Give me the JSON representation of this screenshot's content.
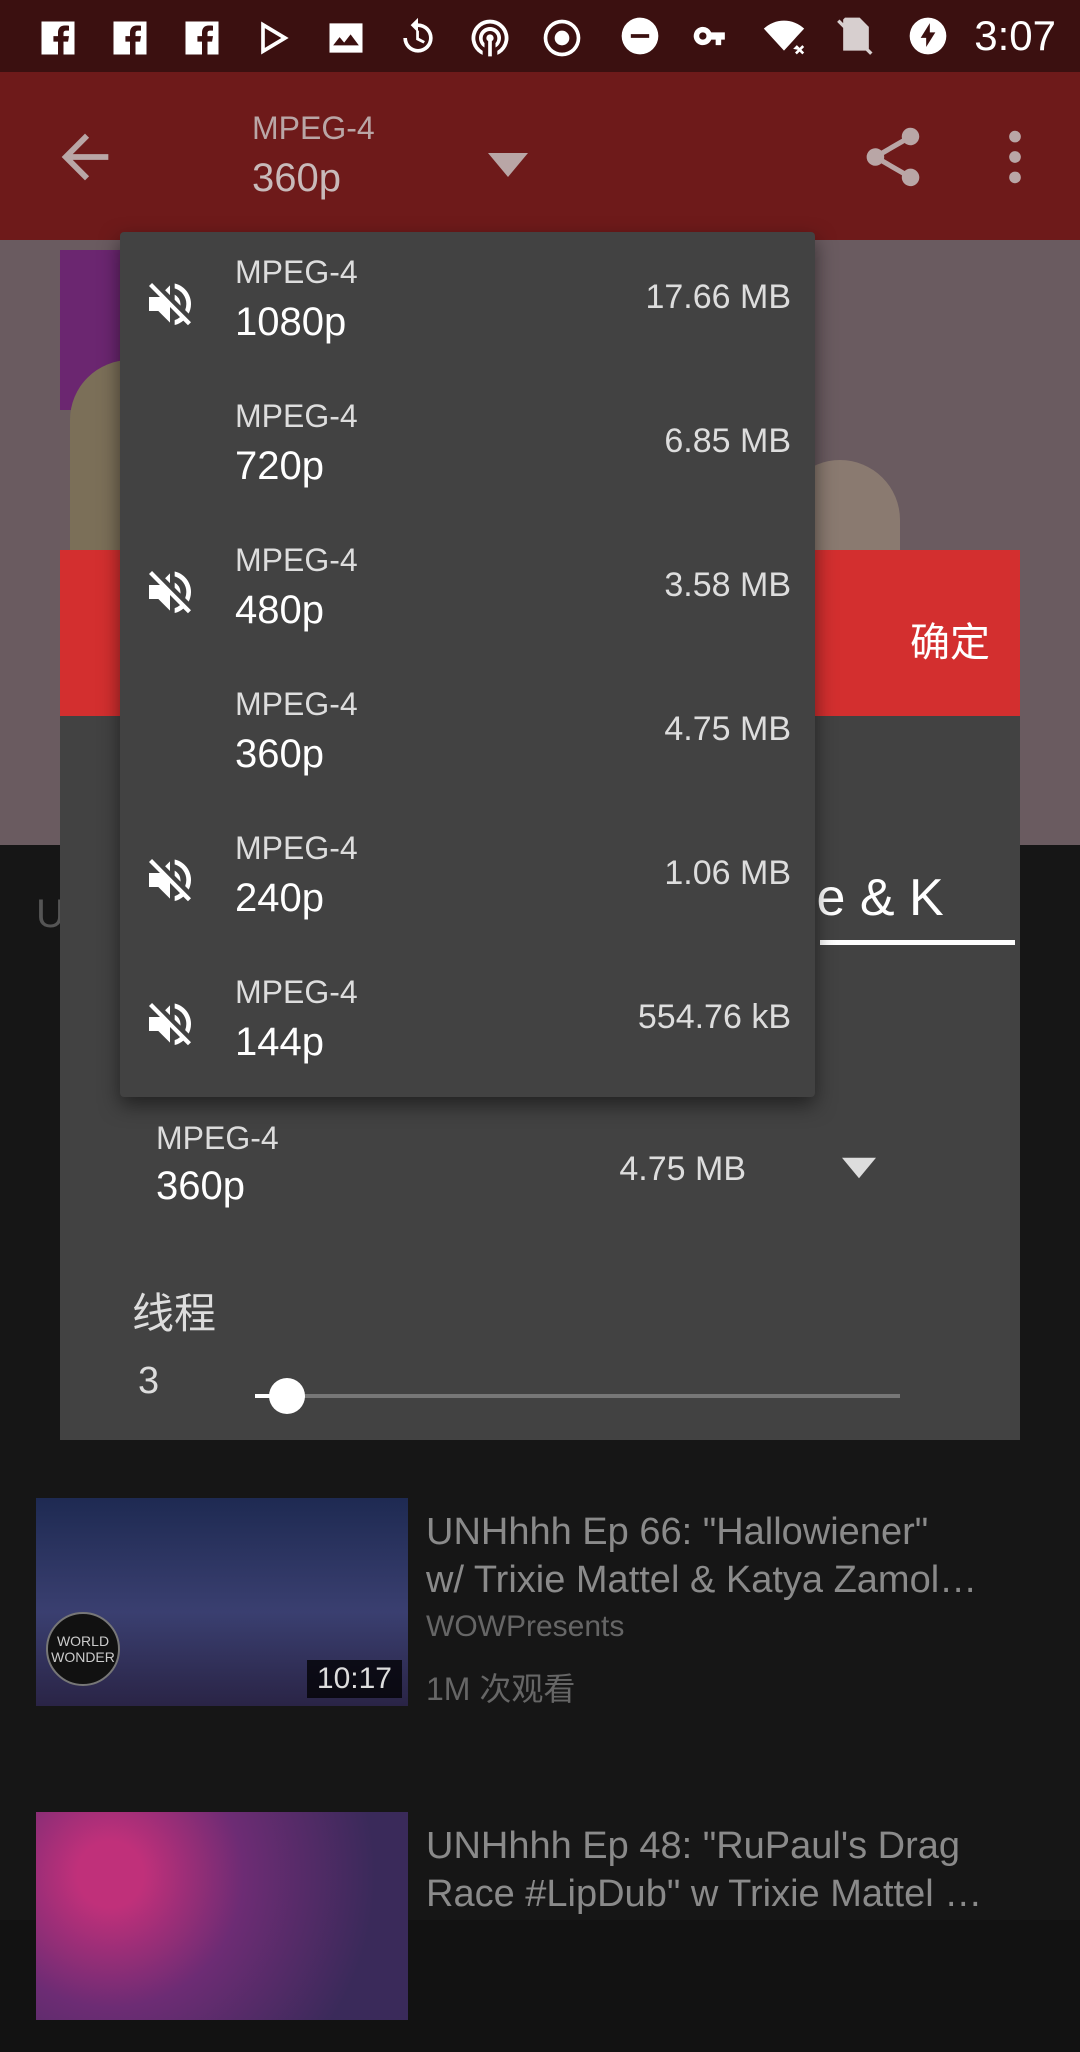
{
  "status_bar": {
    "time": "3:07",
    "icons": [
      "facebook-icon",
      "facebook-icon",
      "facebook-icon",
      "play-store-icon",
      "image-icon",
      "sync-icon",
      "podcast-icon",
      "record-icon",
      "do-not-disturb-icon",
      "vpn-key-icon",
      "wifi-icon",
      "no-sim-icon",
      "battery-charging-icon"
    ]
  },
  "app_bar": {
    "format": "MPEG-4",
    "resolution": "360p"
  },
  "dialog": {
    "ok_label": "确定",
    "name_partial": "ie & K",
    "selected": {
      "format": "MPEG-4",
      "resolution": "360p",
      "size": "4.75 MB"
    },
    "threads_label": "线程",
    "threads_value": "3",
    "threads_fraction": 0.05
  },
  "dropdown": {
    "options": [
      {
        "format": "MPEG-4",
        "resolution": "1080p",
        "size": "17.66 MB",
        "no_audio": true
      },
      {
        "format": "MPEG-4",
        "resolution": "720p",
        "size": "6.85 MB",
        "no_audio": false
      },
      {
        "format": "MPEG-4",
        "resolution": "480p",
        "size": "3.58 MB",
        "no_audio": true
      },
      {
        "format": "MPEG-4",
        "resolution": "360p",
        "size": "4.75 MB",
        "no_audio": false
      },
      {
        "format": "MPEG-4",
        "resolution": "240p",
        "size": "1.06 MB",
        "no_audio": true
      },
      {
        "format": "MPEG-4",
        "resolution": "144p",
        "size": "554.76 kB",
        "no_audio": true
      }
    ]
  },
  "background": {
    "peek_left": "U",
    "related": [
      {
        "title_line1": "UNHhhh Ep 66: \"Hallowiener\"",
        "title_line2": "w/ Trixie Mattel & Katya Zamol…",
        "channel": "WOWPresents",
        "views": "1M 次观看",
        "duration": "10:17",
        "logo_text": "WORLD WONDER"
      },
      {
        "title_line1": "UNHhhh Ep 48: \"RuPaul's Drag",
        "title_line2": "Race #LipDub\" w Trixie Mattel …"
      }
    ]
  }
}
